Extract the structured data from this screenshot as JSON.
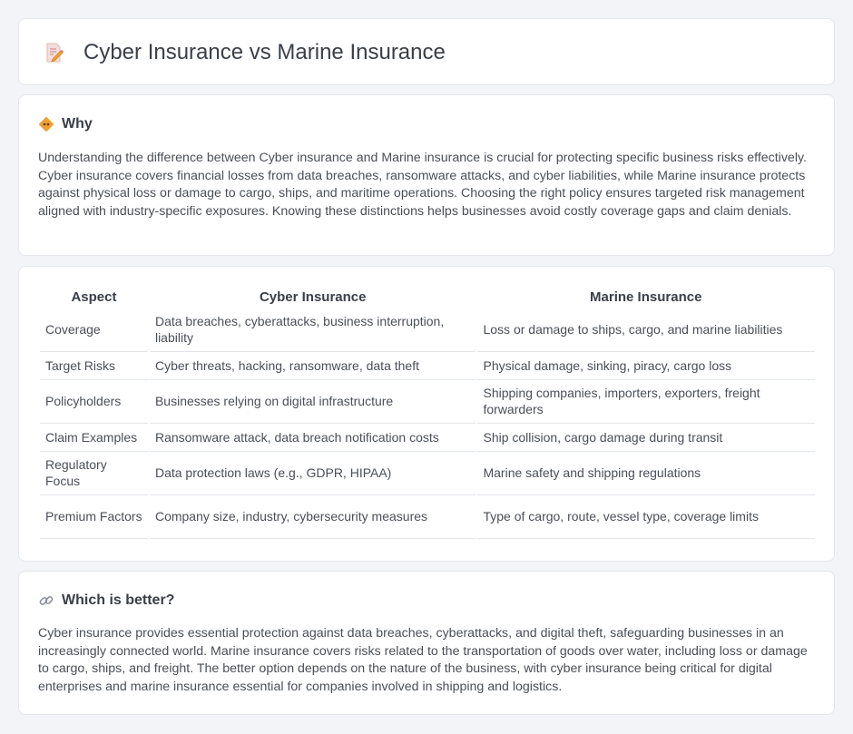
{
  "header": {
    "title": "Cyber Insurance vs Marine Insurance",
    "icon": "document-pencil-icon"
  },
  "why": {
    "title": "Why",
    "icon": "diamond-sign-icon",
    "text": "Understanding the difference between Cyber insurance and Marine insurance is crucial for protecting specific business risks effectively. Cyber insurance covers financial losses from data breaches, ransomware attacks, and cyber liabilities, while Marine insurance protects against physical loss or damage to cargo, ships, and maritime operations. Choosing the right policy ensures targeted risk management aligned with industry-specific exposures. Knowing these distinctions helps businesses avoid costly coverage gaps and claim denials."
  },
  "table": {
    "headers": [
      "Aspect",
      "Cyber Insurance",
      "Marine Insurance"
    ],
    "rows": [
      {
        "aspect": "Coverage",
        "cyber": "Data breaches, cyberattacks, business interruption, liability",
        "marine": "Loss or damage to ships, cargo, and marine liabilities"
      },
      {
        "aspect": "Target Risks",
        "cyber": "Cyber threats, hacking, ransomware, data theft",
        "marine": "Physical damage, sinking, piracy, cargo loss"
      },
      {
        "aspect": "Policyholders",
        "cyber": "Businesses relying on digital infrastructure",
        "marine": "Shipping companies, importers, exporters, freight forwarders"
      },
      {
        "aspect": "Claim Examples",
        "cyber": "Ransomware attack, data breach notification costs",
        "marine": "Ship collision, cargo damage during transit"
      },
      {
        "aspect": "Regulatory Focus",
        "cyber": "Data protection laws (e.g., GDPR, HIPAA)",
        "marine": "Marine safety and shipping regulations"
      },
      {
        "aspect": "Premium Factors",
        "cyber": "Company size, industry, cybersecurity measures",
        "marine": "Type of cargo, route, vessel type, coverage limits"
      }
    ]
  },
  "better": {
    "title": "Which is better?",
    "icon": "link-icon",
    "text": "Cyber insurance provides essential protection against data breaches, cyberattacks, and digital theft, safeguarding businesses in an increasingly connected world. Marine insurance covers risks related to the transportation of goods over water, including loss or damage to cargo, ships, and freight. The better option depends on the nature of the business, with cyber insurance being critical for digital enterprises and marine insurance essential for companies involved in shipping and logistics."
  },
  "colors": {
    "background": "#f2f4f7",
    "card": "#ffffff",
    "accent_orange": "#f0a030",
    "border": "#e3e6eb"
  }
}
